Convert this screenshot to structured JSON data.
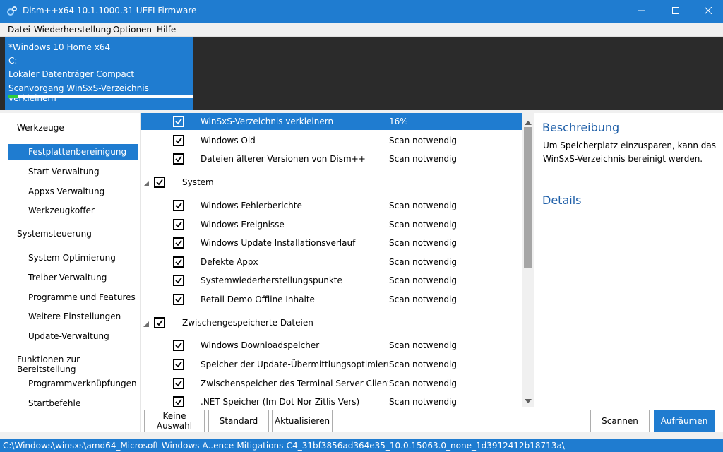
{
  "window": {
    "title": "Dism++x64 10.1.1000.31 UEFI Firmware",
    "icon": "gear-icon"
  },
  "menu": [
    "Datei",
    "Wiederherstellung",
    "Optionen",
    "Hilfe"
  ],
  "session": {
    "os": "*Windows 10 Home x64",
    "drive": "C:",
    "disk": "Lokaler Datenträger Compact",
    "task": "Scanvorgang WinSxS-Verzeichnis verkleinern",
    "progress": 0.05,
    "progress_color": "#2fcf3a"
  },
  "sidebar": {
    "groups": [
      {
        "label": "Werkzeuge",
        "items": [
          "Festplattenbereinigung",
          "Start-Verwaltung",
          "Appxs Verwaltung",
          "Werkzeugkoffer"
        ]
      },
      {
        "label": "Systemsteuerung",
        "items": [
          "System Optimierung",
          "Treiber-Verwaltung",
          "Programme und Features",
          "Weitere Einstellungen",
          "Update-Verwaltung"
        ]
      },
      {
        "label": "Funktionen zur Bereitstellung",
        "items": [
          "Programmverknüpfungen",
          "Startbefehle"
        ]
      }
    ],
    "active": "Festplattenbereinigung"
  },
  "list": {
    "rows": [
      {
        "type": "item",
        "name": "WinSxS-Verzeichnis verkleinern",
        "status": "16%",
        "selected": true
      },
      {
        "type": "item",
        "name": "Windows Old",
        "status": "Scan notwendig"
      },
      {
        "type": "item",
        "name": "Dateien älterer Versionen von Dism++",
        "status": "Scan notwendig"
      },
      {
        "type": "group",
        "name": "System"
      },
      {
        "type": "item",
        "name": "Windows Fehlerberichte",
        "status": "Scan notwendig"
      },
      {
        "type": "item",
        "name": "Windows Ereignisse",
        "status": "Scan notwendig"
      },
      {
        "type": "item",
        "name": "Windows Update Installationsverlauf",
        "status": "Scan notwendig"
      },
      {
        "type": "item",
        "name": "Defekte Appx",
        "status": "Scan notwendig"
      },
      {
        "type": "item",
        "name": "Systemwiederherstellungspunkte",
        "status": "Scan notwendig"
      },
      {
        "type": "item",
        "name": "Retail Demo Offline Inhalte",
        "status": "Scan notwendig"
      },
      {
        "type": "group",
        "name": "Zwischengespeicherte Dateien"
      },
      {
        "type": "item",
        "name": "Windows Downloadspeicher",
        "status": "Scan notwendig"
      },
      {
        "type": "item",
        "name": "Speicher der Update-Übermittlungsoptimierung",
        "status": "Scan notwendig"
      },
      {
        "type": "item",
        "name": "Zwischenspeicher des Terminal Server Client",
        "status": "Scan notwendig"
      },
      {
        "type": "item",
        "name": ".NET Speicher (Im Dot Nor Zitlis Vers)",
        "status": "Scan notwendig"
      }
    ]
  },
  "details": {
    "heading": "Beschreibung",
    "text": "Um Speicherplatz einzusparen, kann das WinSxS-Verzeichnis bereinigt werden.",
    "details_heading": "Details"
  },
  "buttons": {
    "none": "Keine Auswahl",
    "default": "Standard",
    "refresh": "Aktualisieren",
    "scan": "Scannen",
    "clean": "Aufräumen"
  },
  "statusbar": "C:\\Windows\\winsxs\\amd64_Microsoft-Windows-A..ence-Mitigations-C4_31bf3856ad364e35_10.0.15063.0_none_1d3912412b18713a\\",
  "colors": {
    "accent": "#1f7cd0",
    "dark": "#2b2b2b"
  }
}
